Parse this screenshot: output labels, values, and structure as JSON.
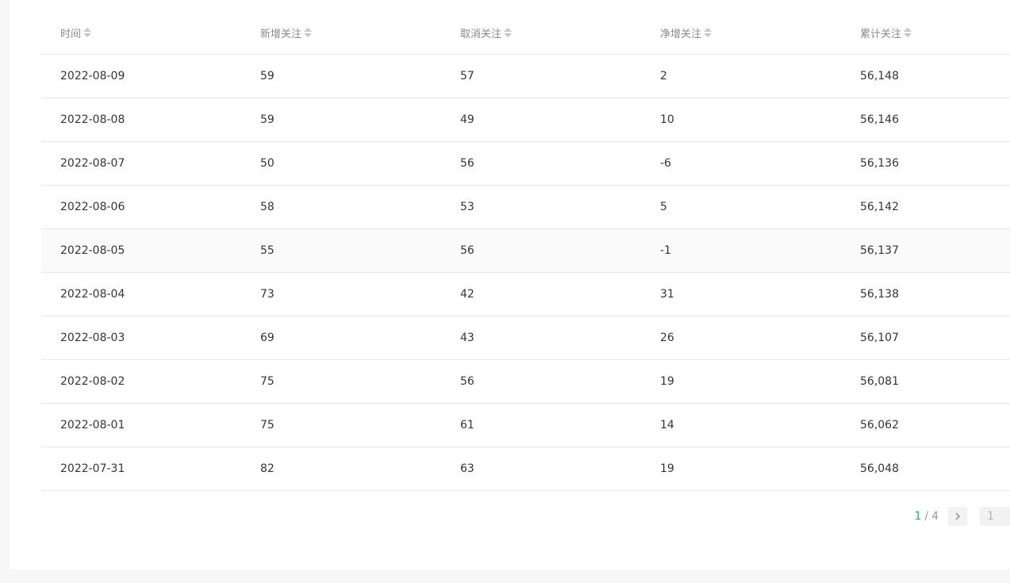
{
  "table": {
    "headers": [
      "时间",
      "新增关注",
      "取消关注",
      "净增关注",
      "累计关注"
    ],
    "rows": [
      [
        "2022-08-09",
        "59",
        "57",
        "2",
        "56,148"
      ],
      [
        "2022-08-08",
        "59",
        "49",
        "10",
        "56,146"
      ],
      [
        "2022-08-07",
        "50",
        "56",
        "-6",
        "56,136"
      ],
      [
        "2022-08-06",
        "58",
        "53",
        "5",
        "56,142"
      ],
      [
        "2022-08-05",
        "55",
        "56",
        "-1",
        "56,137"
      ],
      [
        "2022-08-04",
        "73",
        "42",
        "31",
        "56,138"
      ],
      [
        "2022-08-03",
        "69",
        "43",
        "26",
        "56,107"
      ],
      [
        "2022-08-02",
        "75",
        "56",
        "19",
        "56,081"
      ],
      [
        "2022-08-01",
        "75",
        "61",
        "14",
        "56,062"
      ],
      [
        "2022-07-31",
        "82",
        "63",
        "19",
        "56,048"
      ]
    ],
    "highlighted_row_index": 4
  },
  "pagination": {
    "current": "1",
    "separator": "/",
    "total": "4",
    "goto_value": "1"
  },
  "icons": {
    "sort": "sort-icon",
    "next": "chevron-right-icon"
  },
  "colors": {
    "accent": "#07c160",
    "border": "#e7e7eb",
    "text": "#353535",
    "header_text": "#8a8a8a"
  }
}
